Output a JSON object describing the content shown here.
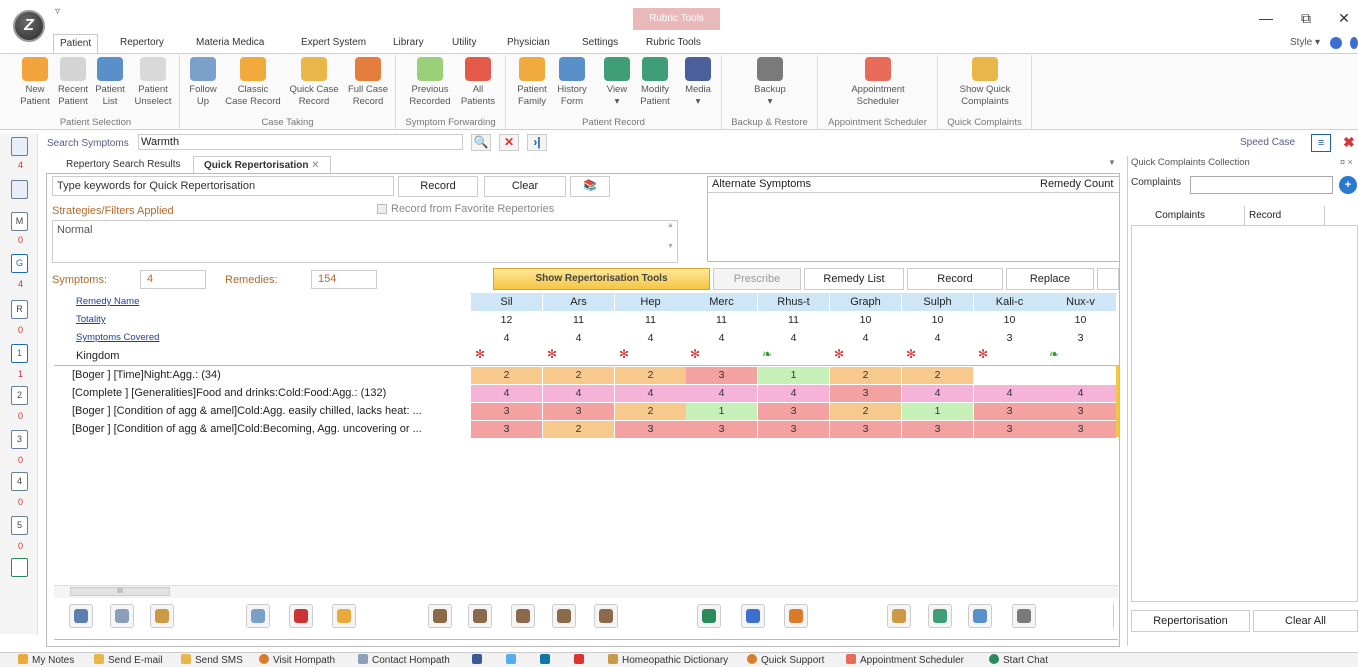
{
  "window": {
    "logo_letter": "Z",
    "quick_access": "▿",
    "context_title": "Rubric Tools",
    "minimize": "—",
    "restore": "⧉",
    "close": "✕"
  },
  "tabs": [
    "Patient",
    "Repertory",
    "Materia Medica",
    "Expert System",
    "Library",
    "Utility",
    "Physician",
    "Settings",
    "Rubric Tools"
  ],
  "style_label": "Style",
  "ribbon": {
    "groups": [
      {
        "label": "Patient Selection",
        "buttons": [
          [
            "New",
            "Patient"
          ],
          [
            "Recent",
            "Patient"
          ],
          [
            "Patient",
            "List"
          ],
          [
            "Patient",
            "Unselect"
          ]
        ]
      },
      {
        "label": "Case Taking",
        "buttons": [
          [
            "Follow",
            "Up"
          ],
          [
            "Classic",
            "Case Record"
          ],
          [
            "Quick Case",
            "Record"
          ],
          [
            "Full Case",
            "Record"
          ]
        ]
      },
      {
        "label": "Symptom Forwarding",
        "buttons": [
          [
            "Previous",
            "Recorded"
          ],
          [
            "All",
            "Patients"
          ]
        ]
      },
      {
        "label": "Patient Record",
        "buttons": [
          [
            "Patient",
            "Family"
          ],
          [
            "History",
            "Form"
          ],
          [
            "View",
            "▾"
          ],
          [
            "Modify",
            "Patient"
          ],
          [
            "Media",
            "▾"
          ]
        ]
      },
      {
        "label": "Backup & Restore",
        "buttons": [
          [
            "Backup",
            "▾"
          ]
        ]
      },
      {
        "label": "Appointment Scheduler",
        "buttons": [
          [
            "Appointment",
            "Scheduler"
          ]
        ]
      },
      {
        "label": "Quick Complaints",
        "buttons": [
          [
            "Show Quick",
            "Complaints"
          ]
        ]
      }
    ]
  },
  "search": {
    "label": "Search Symptoms",
    "value": "Warmth",
    "search_icon": "🔍",
    "clear_icon": "✕",
    "next_icon": "›|"
  },
  "speed_case": "Speed Case",
  "left_rail": {
    "counts": [
      "4",
      "",
      "0",
      "4",
      "0",
      "1",
      "0",
      "0",
      "0",
      "0",
      ""
    ],
    "letters": [
      "",
      "",
      "M",
      "G",
      "R",
      "1",
      "2",
      "3",
      "4",
      "5",
      ""
    ]
  },
  "doc_tabs": {
    "tab1": "Repertory Search Results",
    "tab2": "Quick Repertorisation",
    "close": "✕"
  },
  "quick_rep": {
    "keywords_placeholder": "Type keywords for Quick Repertorisation",
    "record": "Record",
    "clear": "Clear",
    "strategies": "Strategies/Filters Applied",
    "favorite": "Record from Favorite Repertories",
    "strategy_value": "Normal",
    "alternate": "Alternate Symptoms",
    "remedy_count": "Remedy Count",
    "symptoms_label": "Symptoms:",
    "symptoms_value": "4",
    "remedies_label": "Remedies:",
    "remedies_value": "154",
    "show_tools": "Show Repertorisation Tools",
    "prescribe": "Prescribe",
    "remedy_list": "Remedy List",
    "record_btn": "Record",
    "replace": "Replace"
  },
  "grid": {
    "row_labels": [
      "Remedy Name",
      "Totality",
      "Symptoms Covered",
      "Kingdom"
    ],
    "remedies": [
      "Sil",
      "Ars",
      "Hep",
      "Merc",
      "Rhus-t",
      "Graph",
      "Sulph",
      "Kali-c",
      "Nux-v"
    ],
    "totality": [
      "12",
      "11",
      "11",
      "11",
      "11",
      "10",
      "10",
      "10",
      "10"
    ],
    "covered": [
      "4",
      "4",
      "4",
      "4",
      "4",
      "4",
      "4",
      "3",
      "3"
    ],
    "kingdom": [
      "mineral",
      "mineral",
      "mineral",
      "mineral",
      "plant",
      "mineral",
      "mineral",
      "mineral",
      "plant"
    ],
    "kingdom_glyphs": [
      "✻",
      "✻",
      "✻",
      "✻",
      "❧",
      "✻",
      "✻",
      "✻",
      "❧"
    ],
    "symptoms": [
      {
        "text": "[Boger ] [Time]Night:Agg.: (34)",
        "grades": [
          2,
          2,
          2,
          3,
          1,
          2,
          2,
          null,
          null
        ]
      },
      {
        "text": "[Complete ] [Generalities]Food and drinks:Cold:Food:Agg.: (132)",
        "grades": [
          4,
          4,
          4,
          4,
          4,
          3,
          4,
          4,
          4
        ]
      },
      {
        "text": "[Boger ] [Condition of agg & amel]Cold:Agg. easily chilled, lacks heat: ...",
        "grades": [
          3,
          3,
          2,
          1,
          3,
          2,
          1,
          3,
          3
        ]
      },
      {
        "text": "[Boger ] [Condition of agg & amel]Cold:Becoming, Agg. uncovering or ...",
        "grades": [
          3,
          2,
          3,
          3,
          3,
          3,
          3,
          3,
          3
        ]
      }
    ]
  },
  "right_panel": {
    "title": "Quick Complaints Collection",
    "complaints_label": "Complaints",
    "col1": "Complaints",
    "col2": "Record",
    "repertorisation": "Repertorisation",
    "clear_all": "Clear All"
  },
  "status_bar": [
    "My Notes",
    "Send E-mail",
    "Send SMS",
    "Visit Hompath",
    "Contact Hompath",
    "Homeopathic Dictionary",
    "Quick Support",
    "Appointment Scheduler",
    "Start Chat"
  ],
  "colors": {
    "grade1": "#c7f0b8",
    "grade2": "#f7c98c",
    "grade3": "#f3a1a1",
    "grade4": "#f5b3d8",
    "header": "#cfe6f7",
    "accent": "#f4c542"
  }
}
